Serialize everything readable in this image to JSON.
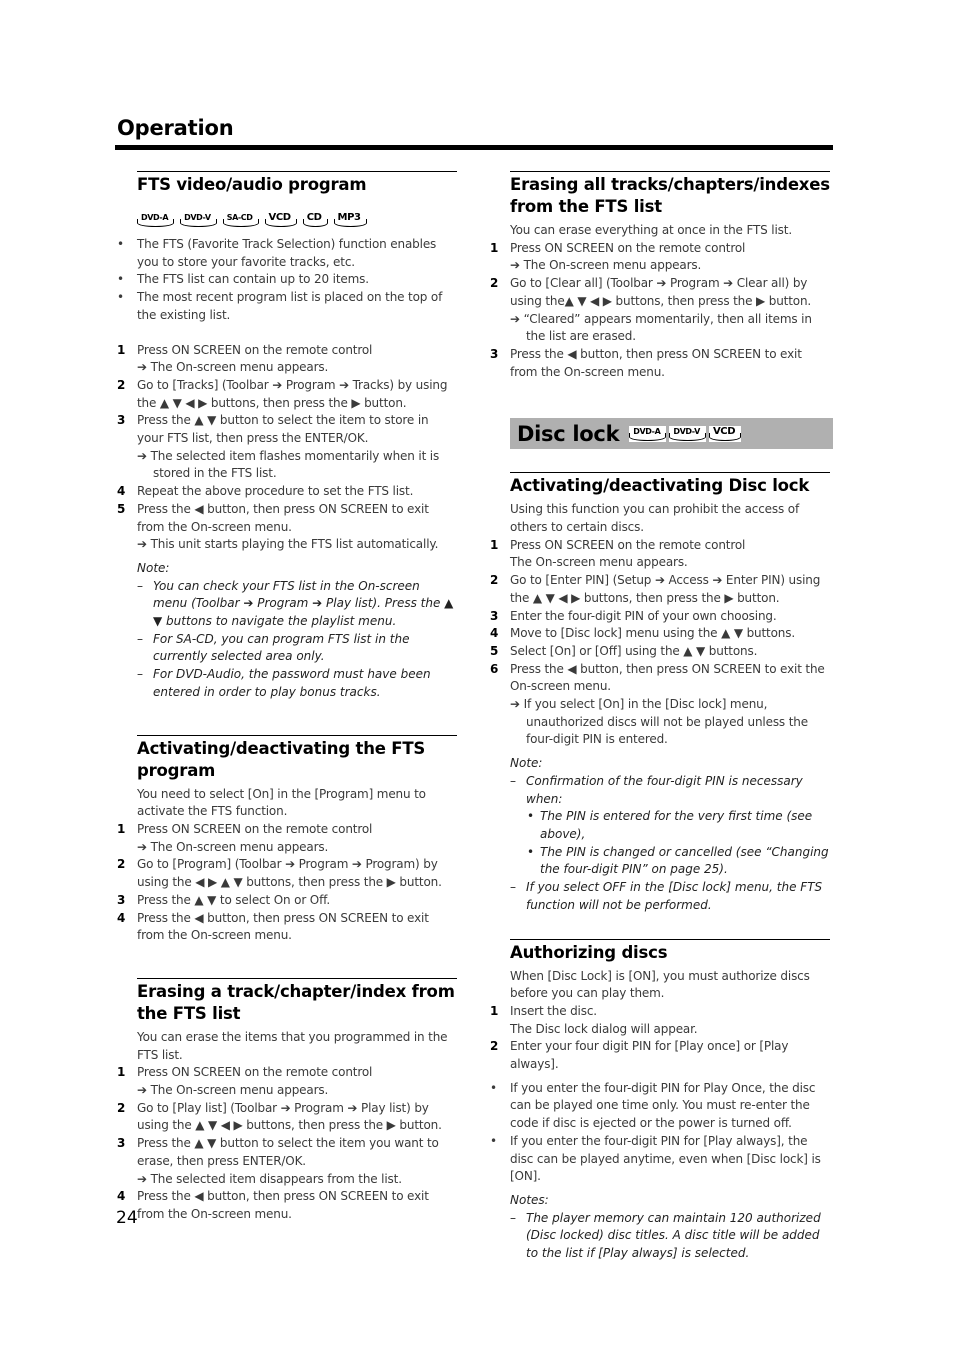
{
  "section_title": "Operation",
  "page_number": "24",
  "icons": {
    "arrow": "➔",
    "up": "▲",
    "down": "▼",
    "left": "◀",
    "right": "▶"
  },
  "fts_program": {
    "heading": "FTS video/audio program",
    "disc_types": [
      "DVD-A",
      "DVD-V",
      "SA-CD",
      "VCD",
      "CD",
      "MP3"
    ],
    "bullets": [
      "The FTS (Favorite Track Selection) function enables you to store your favorite tracks, etc.",
      "The FTS list can contain up to 20 items.",
      "The most recent program list is placed on the top of the existing list."
    ],
    "steps": [
      {
        "num": "1",
        "text": "Press ON SCREEN on the remote control",
        "result": "The On-screen menu appears."
      },
      {
        "num": "2",
        "text": "Go to [Tracks] (Toolbar ➔ Program ➔ Tracks) by using the ▲ ▼ ◀ ▶ buttons, then press the ▶ button."
      },
      {
        "num": "3",
        "text": "Press the ▲ ▼  button to select the item to store in your FTS list, then press the ENTER/OK.",
        "result": "The selected item flashes momentarily when it is stored in the FTS list."
      },
      {
        "num": "4",
        "text": "Repeat the above procedure to set the FTS list."
      },
      {
        "num": "5",
        "text": "Press the ◀ button, then press ON SCREEN to exit from the On-screen menu.",
        "result": "This unit starts playing the FTS list automatically."
      }
    ],
    "note_label": "Note:",
    "notes": [
      "You can check your FTS list in the On-screen menu (Toolbar ➔ Program ➔ Play list). Press the ▲ ▼ buttons to navigate the playlist menu.",
      "For SA-CD, you can program FTS list in the currently selected area only.",
      "For DVD-Audio, the password must have been entered in order to play bonus tracks."
    ]
  },
  "fts_activate": {
    "heading": "Activating/deactivating the FTS program",
    "intro": "You need to select [On] in the [Program] menu to activate the FTS function.",
    "steps": [
      {
        "num": "1",
        "text": "Press ON SCREEN on the remote control",
        "result": "The On-screen menu appears."
      },
      {
        "num": "2",
        "text": "Go to [Program] (Toolbar ➔ Program ➔ Program) by using the ◀ ▶ ▲ ▼ buttons, then press the ▶ button."
      },
      {
        "num": "3",
        "text": "Press the ▲ ▼  to select On or Off."
      },
      {
        "num": "4",
        "text": "Press the ◀ button, then press ON SCREEN to exit from the On-screen menu."
      }
    ]
  },
  "fts_erase_one": {
    "heading": "Erasing a track/chapter/index from the FTS list",
    "intro": "You can erase the items that you programmed in the FTS list.",
    "steps": [
      {
        "num": "1",
        "text": "Press ON SCREEN on the remote control",
        "result": "The On-screen menu appears."
      },
      {
        "num": "2",
        "text": "Go to [Play list] (Toolbar ➔ Program ➔ Play list) by using the ▲ ▼ ◀ ▶ buttons, then press the ▶ button."
      },
      {
        "num": "3",
        "text": "Press the ▲ ▼  button to select the item you want to erase, then press ENTER/OK.",
        "result": "The selected item disappears from the list."
      },
      {
        "num": "4",
        "text": "Press the ◀ button, then press ON SCREEN to exit from the On-screen menu."
      }
    ]
  },
  "fts_erase_all": {
    "heading": "Erasing all tracks/chapters/indexes from the FTS list",
    "intro": "You can erase everything at once in the FTS list.",
    "steps": [
      {
        "num": "1",
        "text": "Press ON SCREEN on the remote control",
        "result": "The On-screen menu appears."
      },
      {
        "num": "2",
        "text": "Go to [Clear all] (Toolbar ➔ Program ➔ Clear all) by using the▲ ▼ ◀ ▶ buttons, then press the ▶ button.",
        "result": "“Cleared” appears momentarily, then all items in the list are erased."
      },
      {
        "num": "3",
        "text": "Press the ◀ button, then press ON SCREEN to exit from the On-screen menu."
      }
    ]
  },
  "disc_lock": {
    "heading": "Disc lock",
    "disc_types": [
      "DVD-A",
      "DVD-V",
      "VCD"
    ],
    "colors": {
      "band": "#b0b0b0"
    }
  },
  "disc_lock_activate": {
    "heading": "Activating/deactivating Disc lock",
    "intro": "Using this function you can prohibit the access of others to certain discs.",
    "steps": [
      {
        "num": "1",
        "text": "Press ON SCREEN on the remote control",
        "plain_result": "The On-screen menu appears."
      },
      {
        "num": "2",
        "text": "Go to [Enter PIN] (Setup ➔ Access ➔ Enter PIN) using the ▲ ▼ ◀ ▶ buttons, then press the ▶ button."
      },
      {
        "num": "3",
        "text": "Enter the four-digit PIN of your own choosing."
      },
      {
        "num": "4",
        "text": "Move to [Disc lock] menu using the ▲ ▼ buttons."
      },
      {
        "num": "5",
        "text": "Select [On] or [Off] using the ▲ ▼ buttons."
      },
      {
        "num": "6",
        "text": "Press the ◀ button, then press ON SCREEN to exit the On-screen menu.",
        "result": "If you select [On] in the [Disc lock] menu, unauthorized discs will not be played unless the four-digit PIN is entered."
      }
    ],
    "note_label": "Note:",
    "note_1": "Confirmation of the four-digit PIN is necessary when:",
    "note_1_sub": [
      "The PIN is entered for the very first time (see above),",
      "The PIN is changed or cancelled (see “Changing the four-digit PIN” on page 25)."
    ],
    "note_2": "If you select OFF in the [Disc lock] menu, the FTS function will not be performed."
  },
  "authorizing": {
    "heading": "Authorizing discs",
    "intro": "When [Disc Lock] is [ON], you must authorize discs before you can play them.",
    "steps": [
      {
        "num": "1",
        "text": "Insert the disc.",
        "plain_result": "The Disc lock dialog will appear."
      },
      {
        "num": "2",
        "text": "Enter your four digit PIN for [Play once] or [Play always]."
      }
    ],
    "bullets": [
      "If you enter the four-digit PIN for Play Once, the disc can be played one time only. You must re-enter the code if disc is ejected or the power is turned off.",
      "If you enter the four-digit PIN for [Play always], the disc can be played anytime, even when [Disc lock] is [ON]."
    ],
    "notes_label": "Notes:",
    "notes": [
      "The player memory can maintain 120 authorized (Disc locked) disc titles. A disc title will be added to the list if [Play always] is selected."
    ]
  }
}
